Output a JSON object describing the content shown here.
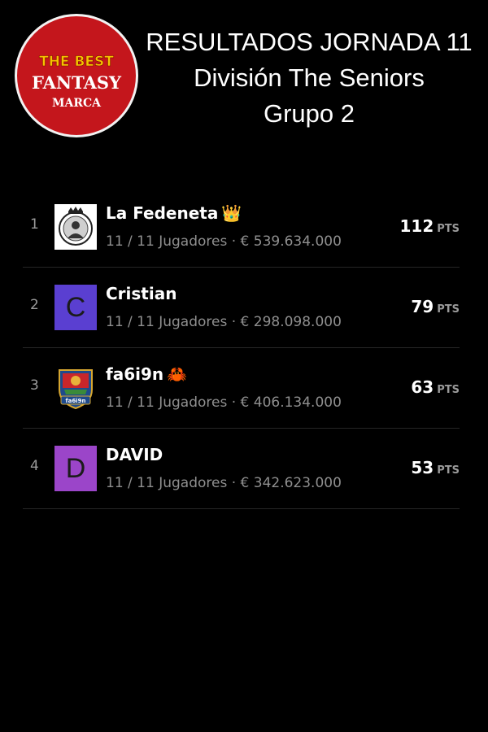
{
  "logo": {
    "line1": "THE BEST",
    "line2": "FANTASY",
    "line3": "MARCA",
    "colors": {
      "background": "#c4161c",
      "accent": "#f4c300",
      "ring": "#f2f2f2"
    }
  },
  "header": {
    "line1": "RESULTADOS JORNADA 11",
    "line2": "División The Seniors",
    "line3": "Grupo 2"
  },
  "ranking": [
    {
      "rank": "1",
      "name": "La Fedeneta",
      "emoji": "👑",
      "meta": "11 / 11 Jugadores · € 539.634.000",
      "points": "112",
      "unit": "PTS",
      "avatar": {
        "type": "photo",
        "icon": "club-crest-icon"
      }
    },
    {
      "rank": "2",
      "name": "Cristian",
      "emoji": "",
      "meta": "11 / 11 Jugadores · € 298.098.000",
      "points": "79",
      "unit": "PTS",
      "avatar": {
        "type": "letter",
        "letter": "C",
        "color": "#5a3fd1"
      }
    },
    {
      "rank": "3",
      "name": "fa6i9n",
      "emoji": "🦀",
      "meta": "11 / 11 Jugadores · € 406.134.000",
      "points": "63",
      "unit": "PTS",
      "avatar": {
        "type": "badge",
        "icon": "team-shield-icon",
        "text": "fa6i9n"
      }
    },
    {
      "rank": "4",
      "name": "DAVID",
      "emoji": "",
      "meta": "11 / 11 Jugadores · € 342.623.000",
      "points": "53",
      "unit": "PTS",
      "avatar": {
        "type": "letter",
        "letter": "D",
        "color": "#9b45c9"
      }
    }
  ]
}
